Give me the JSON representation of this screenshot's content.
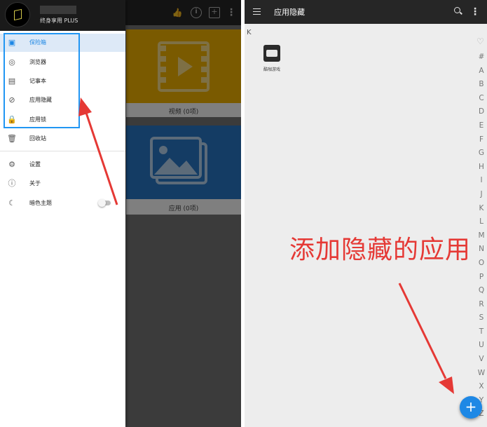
{
  "left_screen": {
    "toolbar_icons": [
      "thumb-up-icon",
      "info-icon",
      "add-box-icon",
      "more-vert-icon"
    ],
    "cards": [
      {
        "icon": "video-icon",
        "caption": "视频 (0项)",
        "color": "#f5b400"
      },
      {
        "icon": "image-icon",
        "caption": "应用 (0项)",
        "color": "#2979c9"
      }
    ],
    "drawer": {
      "plan_label": "终身享用 PLUS",
      "items": [
        {
          "icon": "safe-icon",
          "label": "保险箱",
          "selected": true
        },
        {
          "icon": "chrome-icon",
          "label": "浏览器"
        },
        {
          "icon": "clipboard-icon",
          "label": "记事本"
        },
        {
          "icon": "eye-off-icon",
          "label": "应用隐藏"
        },
        {
          "icon": "lock-icon",
          "label": "应用锁"
        },
        {
          "icon": "trash-icon",
          "label": "回收站"
        },
        {
          "icon": "gear-icon",
          "label": "设置"
        },
        {
          "icon": "info-icon",
          "label": "关于"
        },
        {
          "icon": "moon-icon",
          "label": "暗色主题",
          "toggle": false
        }
      ]
    }
  },
  "right_screen": {
    "title": "应用隐藏",
    "section_letter": "K",
    "apps": [
      {
        "label": "酷咖游戏",
        "icon": "vr-headset-icon"
      }
    ],
    "index_bar": [
      "#",
      "A",
      "B",
      "C",
      "D",
      "E",
      "F",
      "G",
      "H",
      "I",
      "J",
      "K",
      "L",
      "M",
      "N",
      "O",
      "P",
      "Q",
      "R",
      "S",
      "T",
      "U",
      "V",
      "W",
      "X",
      "Y",
      "Z"
    ],
    "annotation": "添加隐藏的应用",
    "fab_label": "+"
  },
  "colors": {
    "accent": "#1e88e5",
    "annotation_red": "#e53935",
    "highlight_blue": "#2196f3"
  }
}
